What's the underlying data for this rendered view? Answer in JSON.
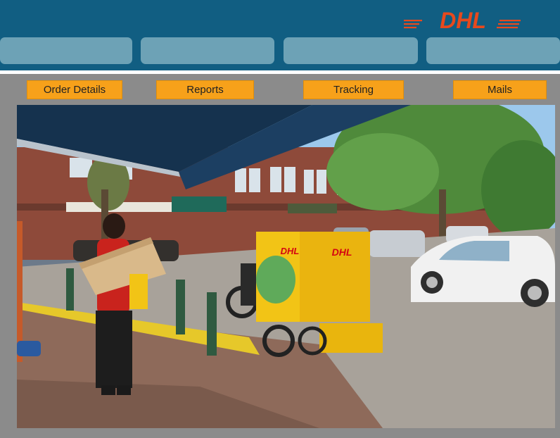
{
  "brand": {
    "logo_text": "DHL",
    "primary_color": "#115e82",
    "accent_color": "#f7a11a",
    "logo_color": "#d40511"
  },
  "nav": {
    "tabs": [
      "",
      "",
      "",
      ""
    ]
  },
  "actions": {
    "order_details": "Order Details",
    "reports": "Reports",
    "tracking": "Tracking",
    "mails": "Mails"
  },
  "hero": {
    "vehicle_brand": "DHL"
  }
}
